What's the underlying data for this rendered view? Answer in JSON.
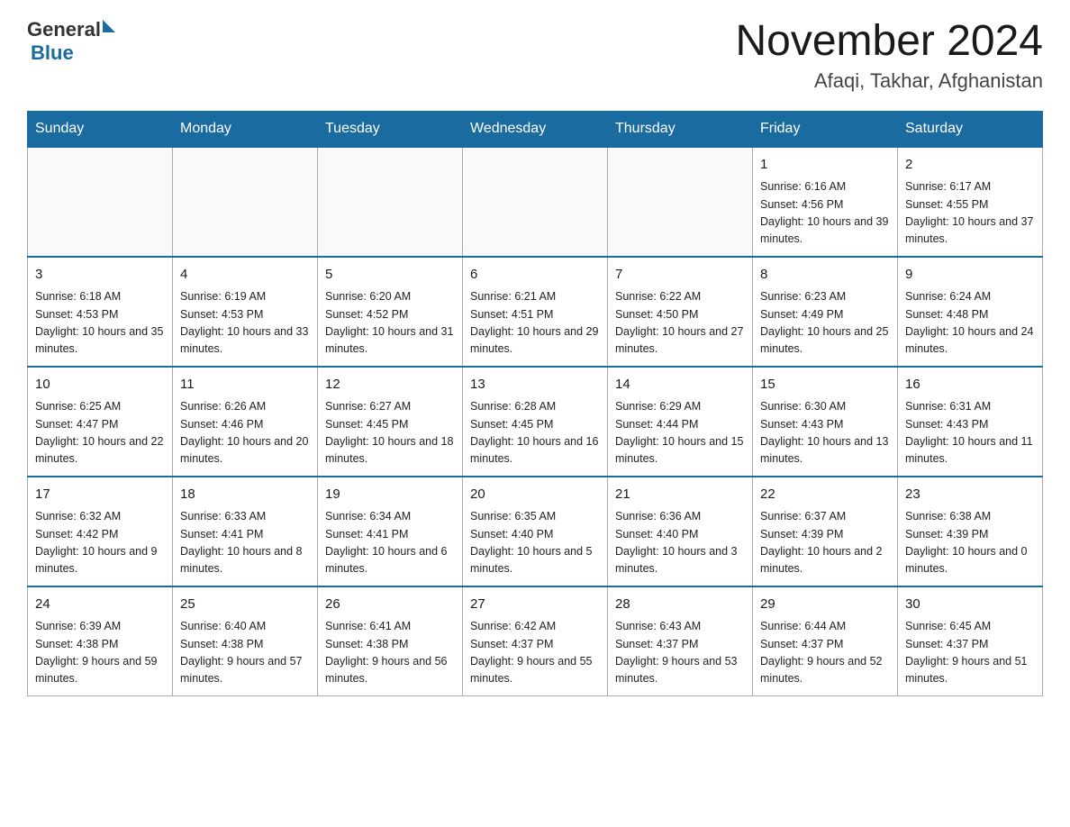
{
  "header": {
    "logo_general": "General",
    "logo_blue": "Blue",
    "title": "November 2024",
    "subtitle": "Afaqi, Takhar, Afghanistan"
  },
  "days_of_week": [
    "Sunday",
    "Monday",
    "Tuesday",
    "Wednesday",
    "Thursday",
    "Friday",
    "Saturday"
  ],
  "weeks": [
    [
      {
        "day": "",
        "info": ""
      },
      {
        "day": "",
        "info": ""
      },
      {
        "day": "",
        "info": ""
      },
      {
        "day": "",
        "info": ""
      },
      {
        "day": "",
        "info": ""
      },
      {
        "day": "1",
        "info": "Sunrise: 6:16 AM\nSunset: 4:56 PM\nDaylight: 10 hours and 39 minutes."
      },
      {
        "day": "2",
        "info": "Sunrise: 6:17 AM\nSunset: 4:55 PM\nDaylight: 10 hours and 37 minutes."
      }
    ],
    [
      {
        "day": "3",
        "info": "Sunrise: 6:18 AM\nSunset: 4:53 PM\nDaylight: 10 hours and 35 minutes."
      },
      {
        "day": "4",
        "info": "Sunrise: 6:19 AM\nSunset: 4:53 PM\nDaylight: 10 hours and 33 minutes."
      },
      {
        "day": "5",
        "info": "Sunrise: 6:20 AM\nSunset: 4:52 PM\nDaylight: 10 hours and 31 minutes."
      },
      {
        "day": "6",
        "info": "Sunrise: 6:21 AM\nSunset: 4:51 PM\nDaylight: 10 hours and 29 minutes."
      },
      {
        "day": "7",
        "info": "Sunrise: 6:22 AM\nSunset: 4:50 PM\nDaylight: 10 hours and 27 minutes."
      },
      {
        "day": "8",
        "info": "Sunrise: 6:23 AM\nSunset: 4:49 PM\nDaylight: 10 hours and 25 minutes."
      },
      {
        "day": "9",
        "info": "Sunrise: 6:24 AM\nSunset: 4:48 PM\nDaylight: 10 hours and 24 minutes."
      }
    ],
    [
      {
        "day": "10",
        "info": "Sunrise: 6:25 AM\nSunset: 4:47 PM\nDaylight: 10 hours and 22 minutes."
      },
      {
        "day": "11",
        "info": "Sunrise: 6:26 AM\nSunset: 4:46 PM\nDaylight: 10 hours and 20 minutes."
      },
      {
        "day": "12",
        "info": "Sunrise: 6:27 AM\nSunset: 4:45 PM\nDaylight: 10 hours and 18 minutes."
      },
      {
        "day": "13",
        "info": "Sunrise: 6:28 AM\nSunset: 4:45 PM\nDaylight: 10 hours and 16 minutes."
      },
      {
        "day": "14",
        "info": "Sunrise: 6:29 AM\nSunset: 4:44 PM\nDaylight: 10 hours and 15 minutes."
      },
      {
        "day": "15",
        "info": "Sunrise: 6:30 AM\nSunset: 4:43 PM\nDaylight: 10 hours and 13 minutes."
      },
      {
        "day": "16",
        "info": "Sunrise: 6:31 AM\nSunset: 4:43 PM\nDaylight: 10 hours and 11 minutes."
      }
    ],
    [
      {
        "day": "17",
        "info": "Sunrise: 6:32 AM\nSunset: 4:42 PM\nDaylight: 10 hours and 9 minutes."
      },
      {
        "day": "18",
        "info": "Sunrise: 6:33 AM\nSunset: 4:41 PM\nDaylight: 10 hours and 8 minutes."
      },
      {
        "day": "19",
        "info": "Sunrise: 6:34 AM\nSunset: 4:41 PM\nDaylight: 10 hours and 6 minutes."
      },
      {
        "day": "20",
        "info": "Sunrise: 6:35 AM\nSunset: 4:40 PM\nDaylight: 10 hours and 5 minutes."
      },
      {
        "day": "21",
        "info": "Sunrise: 6:36 AM\nSunset: 4:40 PM\nDaylight: 10 hours and 3 minutes."
      },
      {
        "day": "22",
        "info": "Sunrise: 6:37 AM\nSunset: 4:39 PM\nDaylight: 10 hours and 2 minutes."
      },
      {
        "day": "23",
        "info": "Sunrise: 6:38 AM\nSunset: 4:39 PM\nDaylight: 10 hours and 0 minutes."
      }
    ],
    [
      {
        "day": "24",
        "info": "Sunrise: 6:39 AM\nSunset: 4:38 PM\nDaylight: 9 hours and 59 minutes."
      },
      {
        "day": "25",
        "info": "Sunrise: 6:40 AM\nSunset: 4:38 PM\nDaylight: 9 hours and 57 minutes."
      },
      {
        "day": "26",
        "info": "Sunrise: 6:41 AM\nSunset: 4:38 PM\nDaylight: 9 hours and 56 minutes."
      },
      {
        "day": "27",
        "info": "Sunrise: 6:42 AM\nSunset: 4:37 PM\nDaylight: 9 hours and 55 minutes."
      },
      {
        "day": "28",
        "info": "Sunrise: 6:43 AM\nSunset: 4:37 PM\nDaylight: 9 hours and 53 minutes."
      },
      {
        "day": "29",
        "info": "Sunrise: 6:44 AM\nSunset: 4:37 PM\nDaylight: 9 hours and 52 minutes."
      },
      {
        "day": "30",
        "info": "Sunrise: 6:45 AM\nSunset: 4:37 PM\nDaylight: 9 hours and 51 minutes."
      }
    ]
  ]
}
